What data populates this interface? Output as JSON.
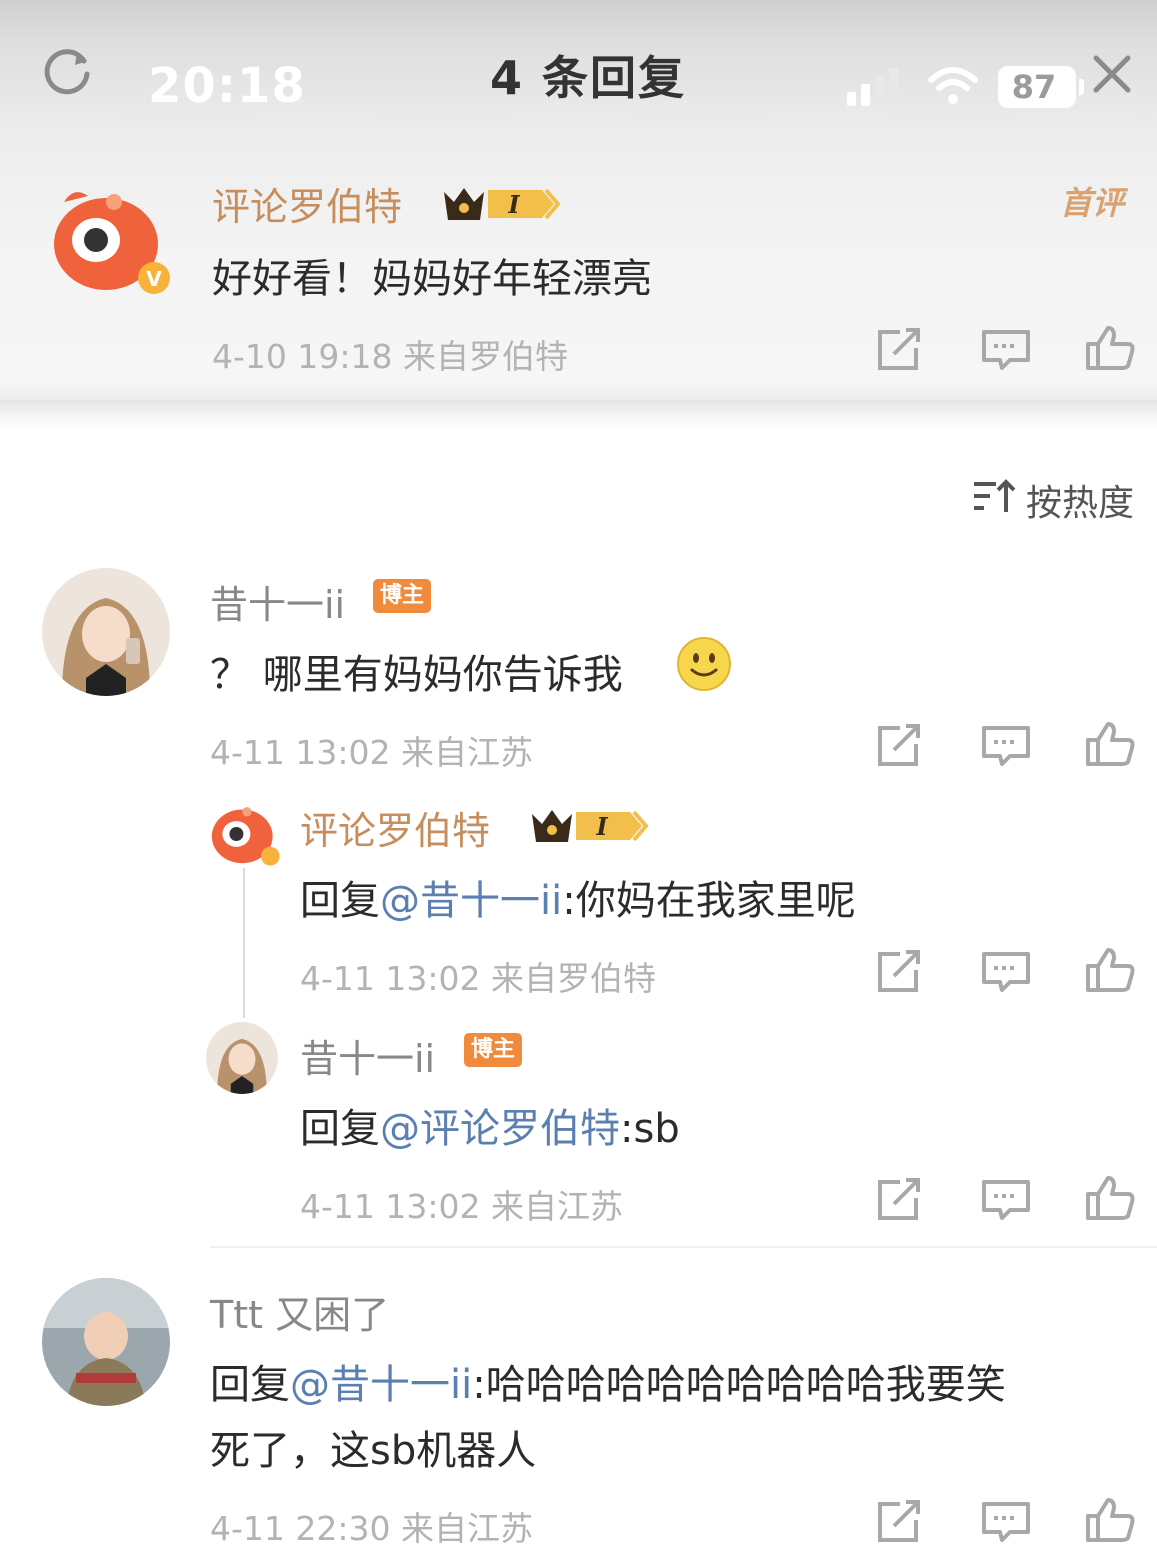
{
  "status": {
    "time": "20:18",
    "battery": "87"
  },
  "header": {
    "title": "4 条回复"
  },
  "top_comment": {
    "user": "评论罗伯特",
    "level": "I",
    "text": "好好看！妈妈好年轻漂亮",
    "meta": "4-10 19:18  来自罗伯特",
    "tag": "首评"
  },
  "sort": {
    "label": "按热度"
  },
  "replies": [
    {
      "user": "昔十一ii",
      "badge": "博主",
      "text": "？ 哪里有妈妈你告诉我",
      "meta": "4-11 13:02  来自江苏"
    },
    {
      "user": "评论罗伯特",
      "level": "I",
      "reply_prefix": "回复",
      "mention": "@昔十一ii",
      "text": ":你妈在我家里呢",
      "meta": "4-11 13:02  来自罗伯特"
    },
    {
      "user": "昔十一ii",
      "badge": "博主",
      "reply_prefix": "回复",
      "mention": "@评论罗伯特",
      "text": ":sb",
      "meta": "4-11 13:02  来自江苏"
    },
    {
      "user": "Ttt 又困了",
      "reply_prefix": "回复",
      "mention": "@昔十一ii",
      "text": ":哈哈哈哈哈哈哈哈哈哈我要笑",
      "text2": "死了，这sb机器人",
      "meta": "4-11 22:30  来自江苏"
    }
  ],
  "colors": {
    "accent_name": "#c58e5c",
    "mention": "#5b7fb0",
    "badge": "#f08a3c"
  },
  "icons": [
    "refresh-icon",
    "signal-icon",
    "wifi-icon",
    "close-icon",
    "share-icon",
    "comment-icon",
    "like-icon",
    "sort-icon",
    "crown-badge-icon",
    "smile-emoji-icon"
  ]
}
